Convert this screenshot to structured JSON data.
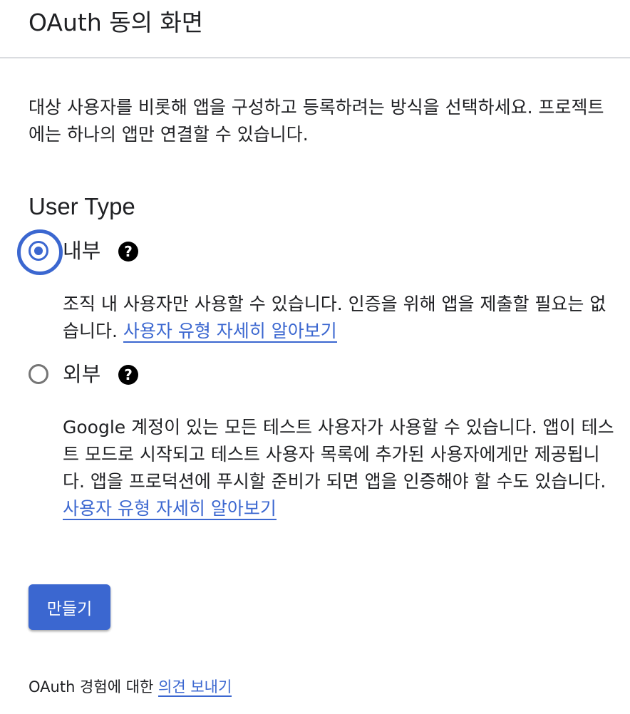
{
  "header": {
    "title": "OAuth 동의 화면"
  },
  "intro": {
    "text": "대상 사용자를 비롯해 앱을 구성하고 등록하려는 방식을 선택하세요. 프로젝트에는 하나의 앱만 연결할 수 있습니다."
  },
  "user_type": {
    "title": "User Type",
    "selected": "내부",
    "options": [
      {
        "label": "내부",
        "checked": true,
        "help_icon": "help-icon",
        "description": "조직 내 사용자만 사용할 수 있습니다. 인증을 위해 앱을 제출할 필요는 없습니다.",
        "link_text": "사용자 유형 자세히 알아보기"
      },
      {
        "label": "외부",
        "checked": false,
        "help_icon": "help-icon",
        "description": "Google 계정이 있는 모든 테스트 사용자가 사용할 수 있습니다. 앱이 테스트 모드로 시작되고 테스트 사용자 목록에 추가된 사용자에게만 제공됩니다. 앱을 프로덕션에 푸시할 준비가 되면 앱을 인증해야 할 수도 있습니다.",
        "link_text": "사용자 유형 자세히 알아보기"
      }
    ]
  },
  "actions": {
    "create_label": "만들기"
  },
  "footer": {
    "feedback_prefix": "OAuth 경험에 대한",
    "feedback_link": "의견 보내기"
  },
  "colors": {
    "accent": "#3b67d0",
    "text": "#202124",
    "divider": "#dadce0",
    "radio_unchecked": "#757575"
  }
}
